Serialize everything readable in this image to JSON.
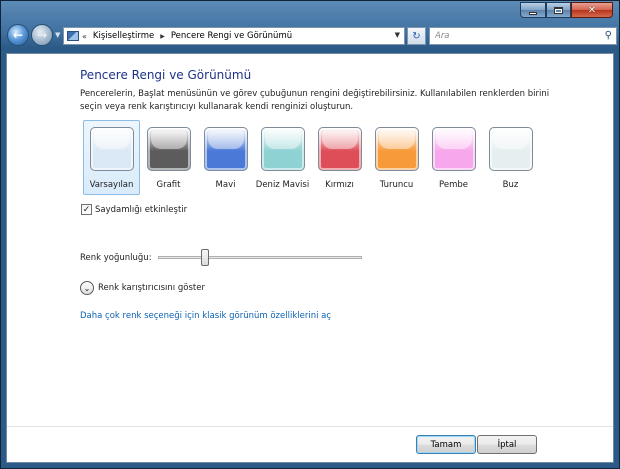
{
  "nav": {
    "breadcrumbs": [
      "Kişiselleştirme",
      "Pencere Rengi ve Görünümü"
    ],
    "search_placeholder": "Ara"
  },
  "page": {
    "title": "Pencere Rengi ve Görünümü",
    "description": "Pencerelerin, Başlat menüsünün ve görev çubuğunun rengini değiştirebilirsiniz. Kullanılabilen renklerden birini seçin veya renk karıştırıcıyı kullanarak kendi renginizi oluşturun."
  },
  "swatches": [
    {
      "label": "Varsayılan",
      "color": "#dbe8f5",
      "selected": true
    },
    {
      "label": "Grafit",
      "color": "#5c5c5c",
      "selected": false
    },
    {
      "label": "Mavi",
      "color": "#4a79d8",
      "selected": false
    },
    {
      "label": "Deniz Mavisi",
      "color": "#8fd2d4",
      "selected": false
    },
    {
      "label": "Kırmızı",
      "color": "#de4e58",
      "selected": false
    },
    {
      "label": "Turuncu",
      "color": "#f79a3a",
      "selected": false
    },
    {
      "label": "Pembe",
      "color": "#f7a8ec",
      "selected": false
    },
    {
      "label": "Buz",
      "color": "#e6efef",
      "selected": false
    }
  ],
  "transparency": {
    "label": "Saydamlığı etkinleştir",
    "checked": true
  },
  "intensity": {
    "label": "Renk yoğunluğu:",
    "value": 0.22
  },
  "mixer": {
    "label": "Renk karıştırıcısını göster"
  },
  "advanced_link": "Daha çok renk seçeneği için klasik görünüm özelliklerini aç",
  "buttons": {
    "ok": "Tamam",
    "cancel": "İptal"
  }
}
